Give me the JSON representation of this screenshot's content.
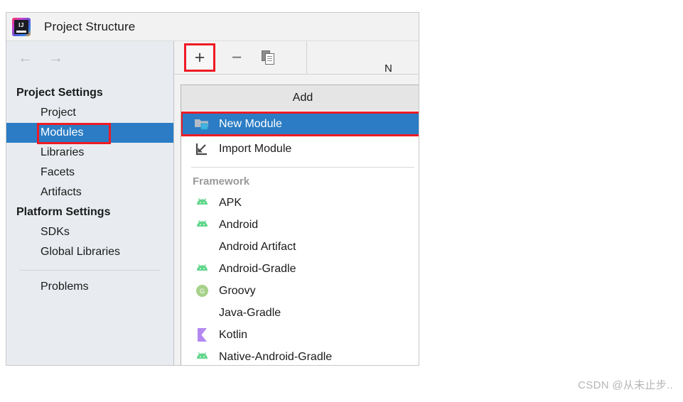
{
  "window": {
    "title": "Project Structure",
    "logo_text": "IJ",
    "logo_icon": "intellij-idea-icon"
  },
  "nav": {
    "back_icon": "arrow-left-icon",
    "forward_icon": "arrow-right-icon"
  },
  "sidebar": {
    "sections": [
      {
        "group": "Project Settings",
        "items": [
          {
            "label": "Project",
            "selected": false
          },
          {
            "label": "Modules",
            "selected": true,
            "highlighted": true
          },
          {
            "label": "Libraries",
            "selected": false
          },
          {
            "label": "Facets",
            "selected": false
          },
          {
            "label": "Artifacts",
            "selected": false
          }
        ]
      },
      {
        "group": "Platform Settings",
        "items": [
          {
            "label": "SDKs",
            "selected": false
          },
          {
            "label": "Global Libraries",
            "selected": false
          }
        ]
      }
    ],
    "footer_items": [
      {
        "label": "Problems",
        "selected": false
      }
    ]
  },
  "toolbar": {
    "add_label": "+",
    "add_icon": "plus-icon",
    "add_highlighted": true,
    "remove_label": "−",
    "remove_icon": "minus-icon",
    "copy_icon": "copy-icon"
  },
  "modules_panel": {
    "name_label": "N"
  },
  "popup": {
    "header": "Add",
    "items": [
      {
        "label": "New Module",
        "icon": "new-module-folder-icon",
        "selected": true,
        "highlighted": true
      },
      {
        "label": "Import Module",
        "icon": "import-module-icon",
        "selected": false,
        "highlighted": false
      }
    ],
    "group_label": "Framework",
    "frameworks": [
      {
        "label": "APK",
        "icon": "android-icon"
      },
      {
        "label": "Android",
        "icon": "android-icon"
      },
      {
        "label": "Android Artifact",
        "icon": "none"
      },
      {
        "label": "Android-Gradle",
        "icon": "android-icon"
      },
      {
        "label": "Groovy",
        "icon": "groovy-icon"
      },
      {
        "label": "Java-Gradle",
        "icon": "none"
      },
      {
        "label": "Kotlin",
        "icon": "kotlin-icon"
      },
      {
        "label": "Native-Android-Gradle",
        "icon": "android-icon"
      }
    ]
  },
  "watermark": {
    "text": "CSDN @从未止步.."
  },
  "colors": {
    "selection_blue": "#2b7cc4",
    "highlight_red": "#ee1b24",
    "android_green": "#5fd68a",
    "kotlin_purple": "#b388f0",
    "groovy_green": "#a7d18a"
  }
}
